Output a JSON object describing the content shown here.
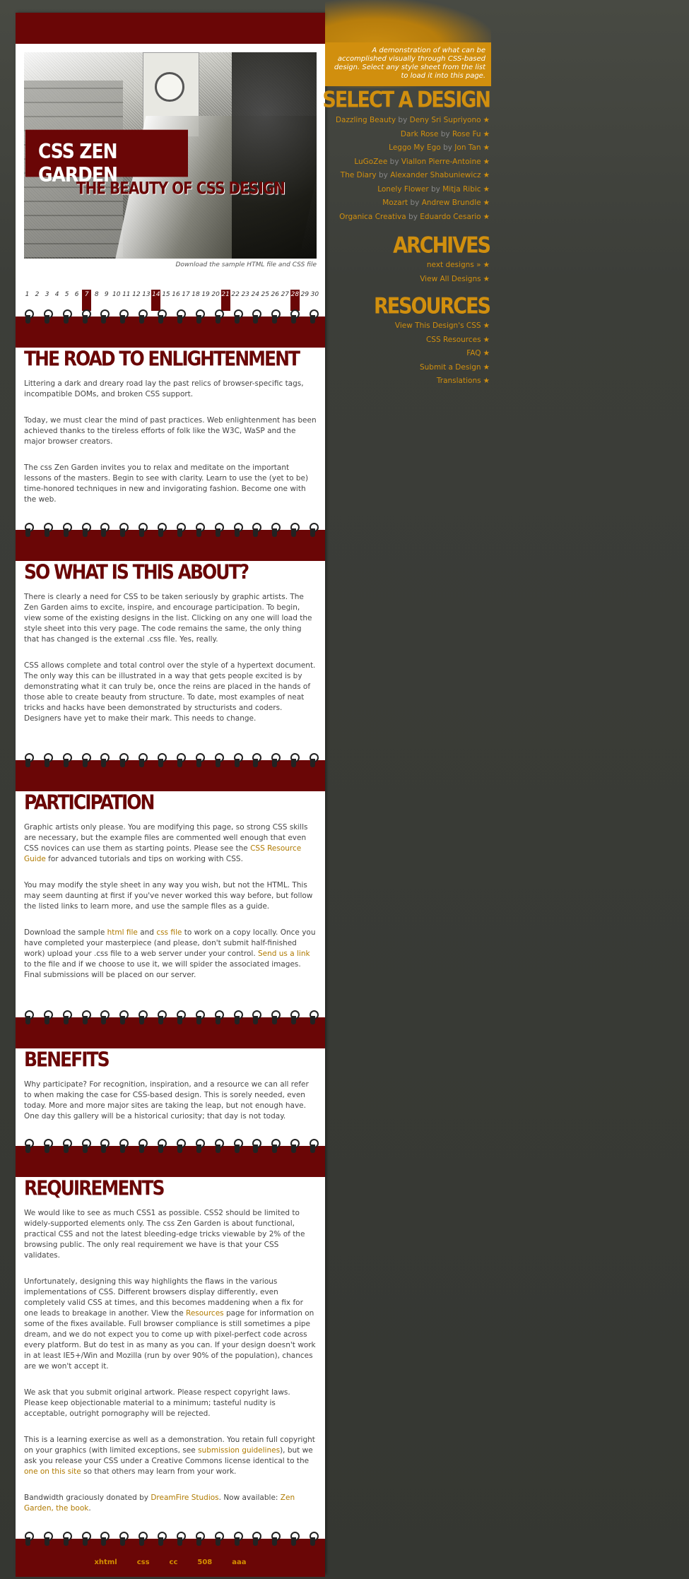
{
  "header": {
    "title": "CSS ZEN GARDEN",
    "subtitle": "THE BEAUTY OF CSS DESIGN",
    "download_note": "Download the sample HTML file and CSS file"
  },
  "calendar": {
    "days": [
      "1",
      "2",
      "3",
      "4",
      "5",
      "6",
      "7",
      "8",
      "9",
      "10",
      "11",
      "12",
      "13",
      "14",
      "15",
      "16",
      "17",
      "18",
      "19",
      "20",
      "21",
      "22",
      "23",
      "24",
      "25",
      "26",
      "27",
      "28",
      "29",
      "30"
    ],
    "highlighted": [
      "7",
      "14",
      "21",
      "28"
    ]
  },
  "intro": "A demonstration of what can be accomplished visually through CSS-based design. Select any style sheet from the list to load it into this page.",
  "sections": {
    "road": {
      "title": "THE ROAD TO ENLIGHTENMENT",
      "p1": "Littering a dark and dreary road lay the past relics of browser-specific tags, incompatible DOMs, and broken CSS support.",
      "p2": "Today, we must clear the mind of past practices. Web enlightenment has been achieved thanks to the tireless efforts of folk like the W3C, WaSP and the major browser creators.",
      "p3": "The css Zen Garden invites you to relax and meditate on the important lessons of the masters. Begin to see with clarity. Learn to use the (yet to be) time-honored techniques in new and invigorating fashion. Become one with the web."
    },
    "about": {
      "title": "SO WHAT IS THIS ABOUT?",
      "p1": "There is clearly a need for CSS to be taken seriously by graphic artists. The Zen Garden aims to excite, inspire, and encourage participation. To begin, view some of the existing designs in the list. Clicking on any one will load the style sheet into this very page. The code remains the same, the only thing that has changed is the external .css file. Yes, really.",
      "p2": "CSS allows complete and total control over the style of a hypertext document. The only way this can be illustrated in a way that gets people excited is by demonstrating what it can truly be, once the reins are placed in the hands of those able to create beauty from structure. To date, most examples of neat tricks and hacks have been demonstrated by structurists and coders. Designers have yet to make their mark. This needs to change."
    },
    "participation": {
      "title": "PARTICIPATION",
      "p1a": "Graphic artists only please. You are modifying this page, so strong CSS skills are necessary, but the example files are commented well enough that even CSS novices can use them as starting points. Please see the ",
      "p1link": "CSS Resource Guide",
      "p1b": " for advanced tutorials and tips on working with CSS.",
      "p2": "You may modify the style sheet in any way you wish, but not the HTML. This may seem daunting at first if you've never worked this way before, but follow the listed links to learn more, and use the sample files as a guide.",
      "p3a": "Download the sample ",
      "p3link1": "html file",
      "p3b": " and ",
      "p3link2": "css file",
      "p3c": " to work on a copy locally. Once you have completed your masterpiece (and please, don't submit half-finished work) upload your .css file to a web server under your control. ",
      "p3link3": "Send us a link",
      "p3d": " to the file and if we choose to use it, we will spider the associated images. Final submissions will be placed on our server."
    },
    "benefits": {
      "title": "BENEFITS",
      "p1": "Why participate? For recognition, inspiration, and a resource we can all refer to when making the case for CSS-based design. This is sorely needed, even today. More and more major sites are taking the leap, but not enough have. One day this gallery will be a historical curiosity; that day is not today."
    },
    "requirements": {
      "title": "REQUIREMENTS",
      "p1": "We would like to see as much CSS1 as possible. CSS2 should be limited to widely-supported elements only. The css Zen Garden is about functional, practical CSS and not the latest bleeding-edge tricks viewable by 2% of the browsing public. The only real requirement we have is that your CSS validates.",
      "p2a": "Unfortunately, designing this way highlights the flaws in the various implementations of CSS. Different browsers display differently, even completely valid CSS at times, and this becomes maddening when a fix for one leads to breakage in another. View the ",
      "p2link": "Resources",
      "p2b": " page for information on some of the fixes available. Full browser compliance is still sometimes a pipe dream, and we do not expect you to come up with pixel-perfect code across every platform. But do test in as many as you can. If your design doesn't work in at least IE5+/Win and Mozilla (run by over 90% of the population), chances are we won't accept it.",
      "p3": "We ask that you submit original artwork. Please respect copyright laws. Please keep objectionable material to a minimum; tasteful nudity is acceptable, outright pornography will be rejected.",
      "p4a": "This is a learning exercise as well as a demonstration. You retain full copyright on your graphics (with limited exceptions, see ",
      "p4link1": "submission guidelines",
      "p4b": "), but we ask you release your CSS under a Creative Commons license identical to the ",
      "p4link2": "one on this site",
      "p4c": " so that others may learn from your work.",
      "p5a": "Bandwidth graciously donated by ",
      "p5link1": "DreamFire Studios",
      "p5b": ". Now available: ",
      "p5link2": "Zen Garden, the book",
      "p5c": "."
    }
  },
  "sidebar": {
    "select_title": "SELECT A DESIGN",
    "by": "by",
    "designs": [
      {
        "name": "Dazzling Beauty",
        "author": "Deny Sri Supriyono"
      },
      {
        "name": "Dark Rose",
        "author": "Rose Fu"
      },
      {
        "name": "Leggo My Ego",
        "author": "Jon Tan"
      },
      {
        "name": "LuGoZee",
        "author": "Viallon Pierre-Antoine"
      },
      {
        "name": "The Diary",
        "author": "Alexander Shabuniewicz"
      },
      {
        "name": "Lonely Flower",
        "author": "Mitja Ribic"
      },
      {
        "name": "Mozart",
        "author": "Andrew Brundle"
      },
      {
        "name": "Organica Creativa",
        "author": "Eduardo Cesario"
      }
    ],
    "archives_title": "ARCHIVES",
    "archives": [
      "next designs »",
      "View All Designs"
    ],
    "resources_title": "RESOURCES",
    "resources": [
      "View This Design's CSS",
      "CSS Resources",
      "FAQ",
      "Submit a Design",
      "Translations"
    ]
  },
  "footer": {
    "links": [
      "xhtml",
      "css",
      "cc",
      "508",
      "aaa"
    ]
  }
}
